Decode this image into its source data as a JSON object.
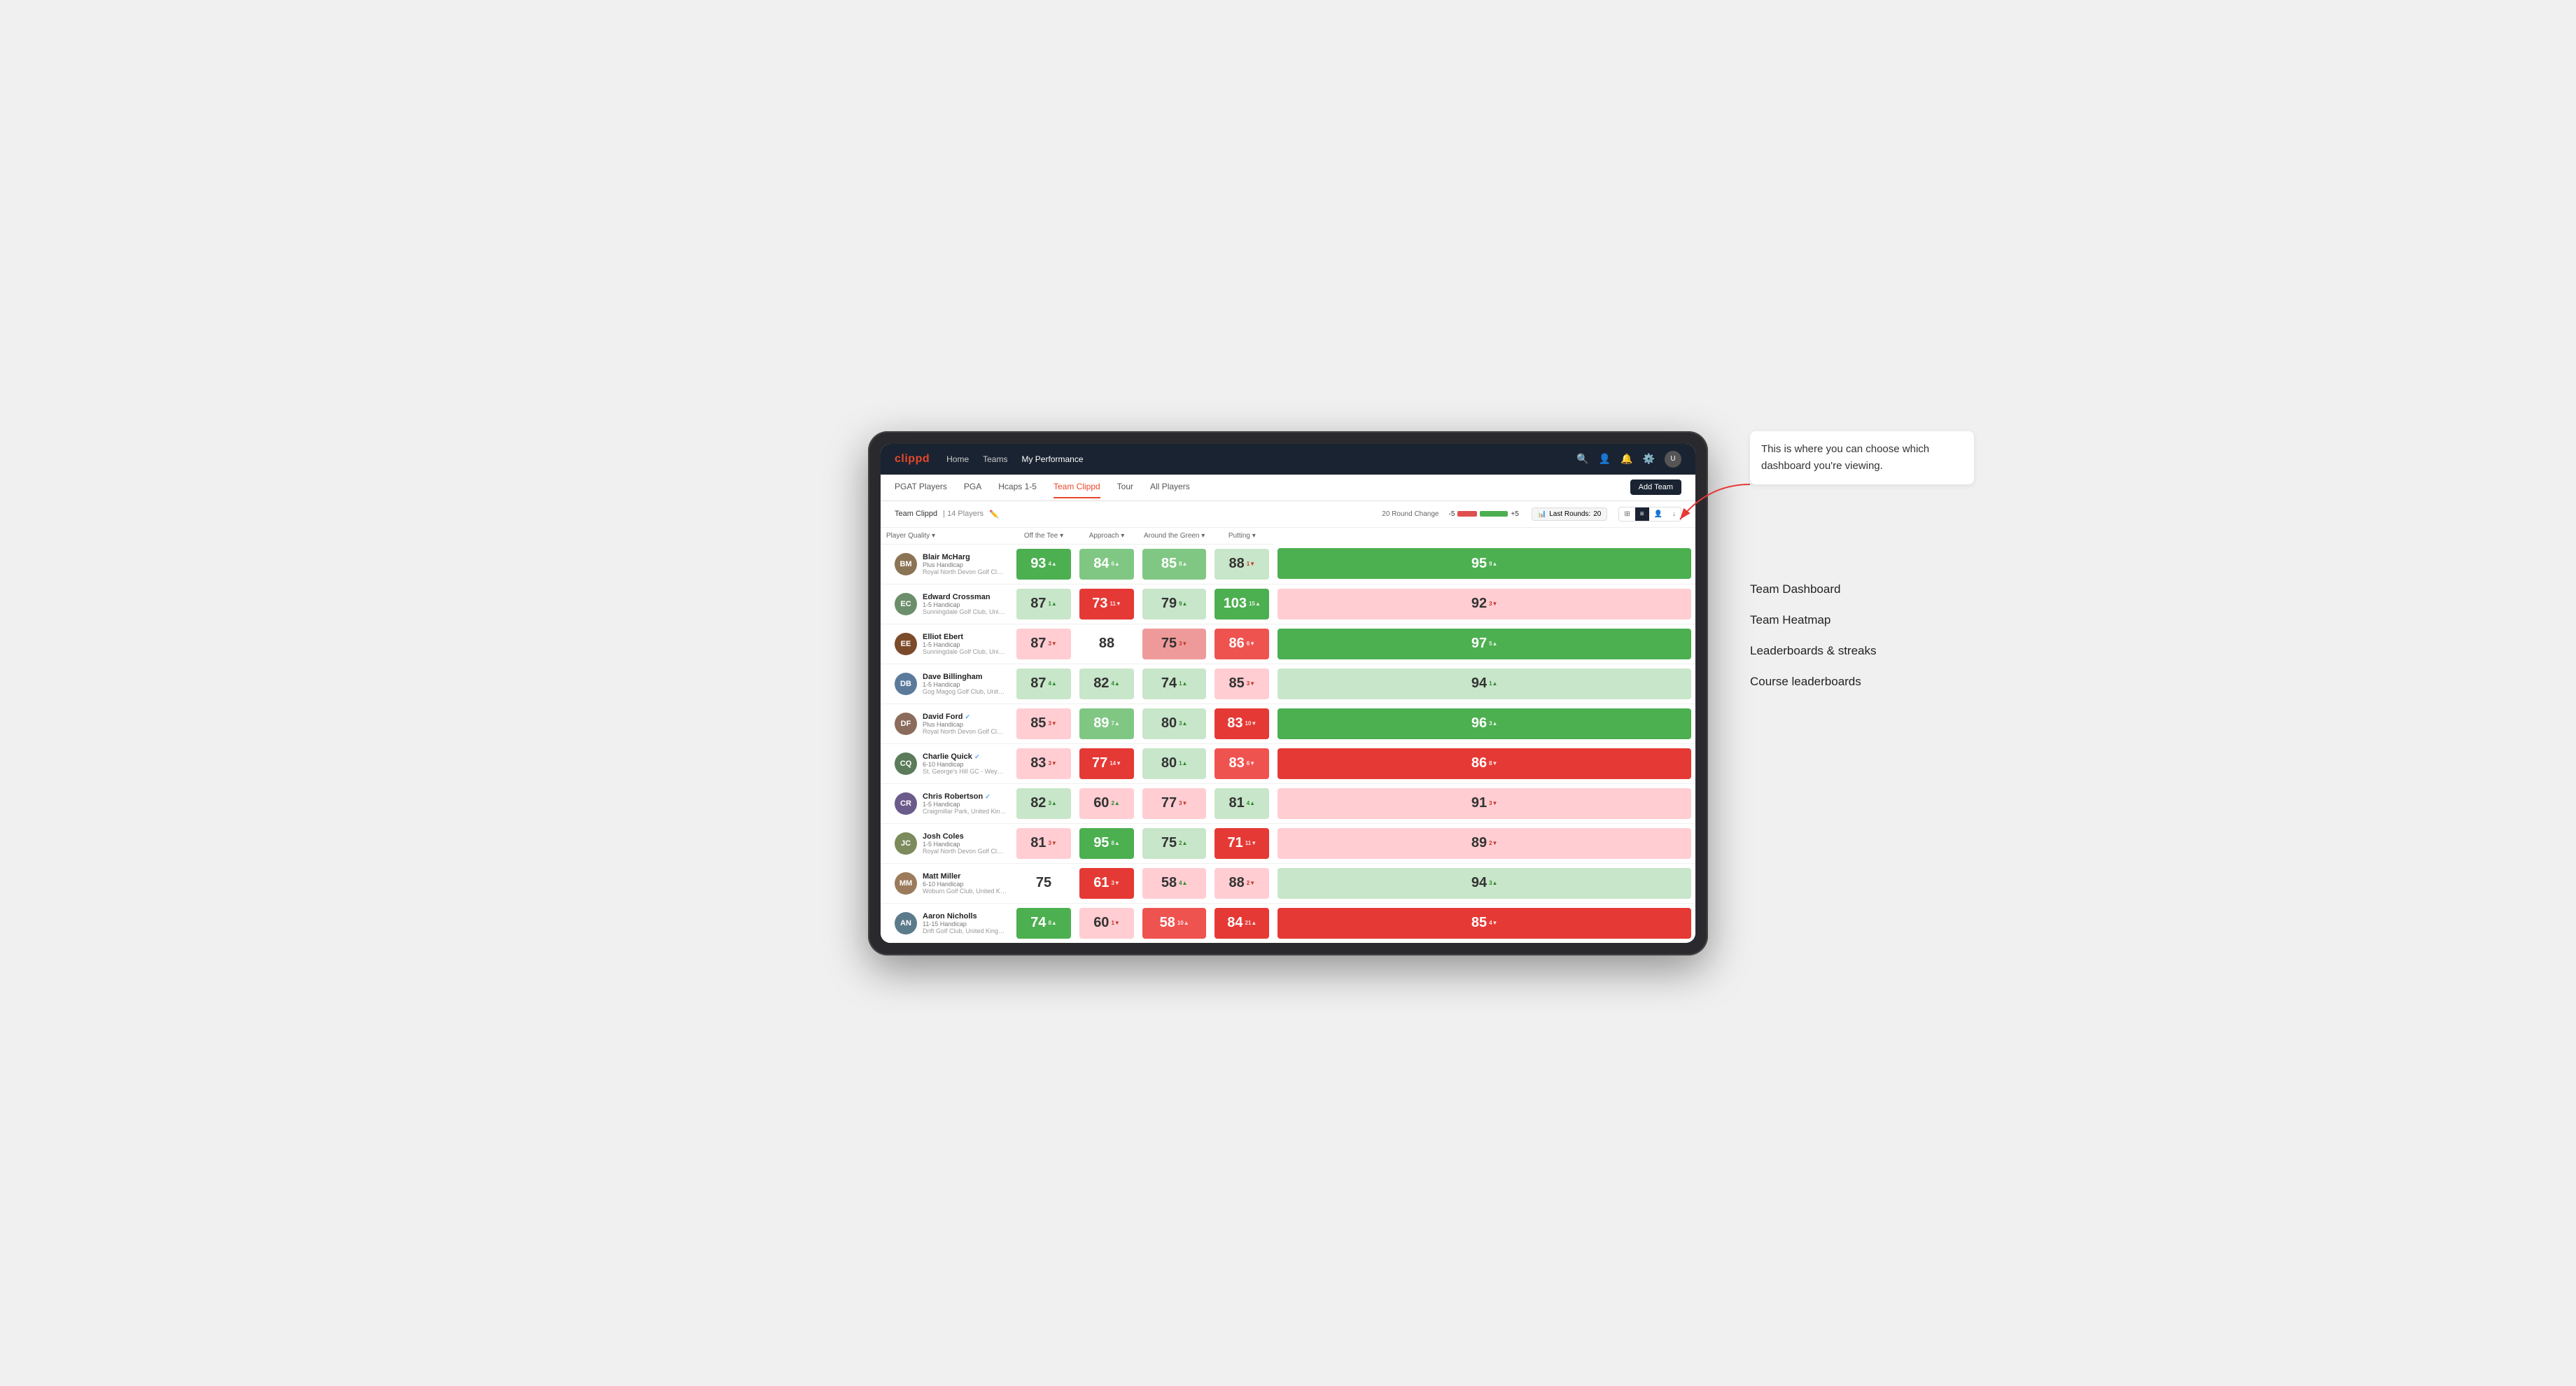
{
  "annotation": {
    "intro": "This is where you can choose which dashboard you're viewing.",
    "items": [
      "Team Dashboard",
      "Team Heatmap",
      "Leaderboards & streaks",
      "Course leaderboards"
    ]
  },
  "nav": {
    "logo": "clippd",
    "links": [
      "Home",
      "Teams",
      "My Performance"
    ],
    "active_link": "My Performance"
  },
  "secondary_nav": {
    "links": [
      "PGAT Players",
      "PGA",
      "Hcaps 1-5",
      "Team Clippd",
      "Tour",
      "All Players"
    ],
    "active": "Team Clippd",
    "add_team_label": "Add Team"
  },
  "team_bar": {
    "name": "Team Clippd",
    "separator": "|",
    "count": "14 Players",
    "round_change_label": "20 Round Change",
    "round_change_neg": "-5",
    "round_change_pos": "+5",
    "last_rounds_label": "Last Rounds:",
    "last_rounds_value": "20"
  },
  "table": {
    "columns": {
      "player_quality": "Player Quality ▾",
      "off_tee": "Off the Tee ▾",
      "approach": "Approach ▾",
      "around_green": "Around the Green ▾",
      "putting": "Putting ▾"
    },
    "rows": [
      {
        "name": "Blair McHarg",
        "handicap": "Plus Handicap",
        "club": "Royal North Devon Golf Club, United Kingdom",
        "initials": "BM",
        "color": "#8B7355",
        "scores": {
          "player_quality": {
            "value": 93,
            "change": 4,
            "dir": "up",
            "bg": "green-bright"
          },
          "off_tee": {
            "value": 84,
            "change": 6,
            "dir": "up",
            "bg": "green-med"
          },
          "approach": {
            "value": 85,
            "change": 8,
            "dir": "up",
            "bg": "green-med"
          },
          "around_green": {
            "value": 88,
            "change": 1,
            "dir": "down",
            "bg": "green-pale"
          },
          "putting": {
            "value": 95,
            "change": 9,
            "dir": "up",
            "bg": "green-bright"
          }
        }
      },
      {
        "name": "Edward Crossman",
        "handicap": "1-5 Handicap",
        "club": "Sunningdale Golf Club, United Kingdom",
        "initials": "EC",
        "color": "#6B8E6B",
        "scores": {
          "player_quality": {
            "value": 87,
            "change": 1,
            "dir": "up",
            "bg": "green-pale"
          },
          "off_tee": {
            "value": 73,
            "change": 11,
            "dir": "down",
            "bg": "red-bright"
          },
          "approach": {
            "value": 79,
            "change": 9,
            "dir": "up",
            "bg": "green-pale"
          },
          "around_green": {
            "value": 103,
            "change": 15,
            "dir": "up",
            "bg": "green-bright"
          },
          "putting": {
            "value": 92,
            "change": 3,
            "dir": "down",
            "bg": "red-pale"
          }
        }
      },
      {
        "name": "Elliot Ebert",
        "handicap": "1-5 Handicap",
        "club": "Sunningdale Golf Club, United Kingdom",
        "initials": "EE",
        "color": "#7B4A2A",
        "scores": {
          "player_quality": {
            "value": 87,
            "change": 3,
            "dir": "down",
            "bg": "red-pale"
          },
          "off_tee": {
            "value": 88,
            "change": null,
            "dir": null,
            "bg": "white"
          },
          "approach": {
            "value": 75,
            "change": 3,
            "dir": "down",
            "bg": "red-light"
          },
          "around_green": {
            "value": 86,
            "change": 6,
            "dir": "down",
            "bg": "red-med"
          },
          "putting": {
            "value": 97,
            "change": 5,
            "dir": "up",
            "bg": "green-bright"
          }
        }
      },
      {
        "name": "Dave Billingham",
        "handicap": "1-5 Handicap",
        "club": "Gog Magog Golf Club, United Kingdom",
        "initials": "DB",
        "color": "#5B7A9B",
        "scores": {
          "player_quality": {
            "value": 87,
            "change": 4,
            "dir": "up",
            "bg": "green-pale"
          },
          "off_tee": {
            "value": 82,
            "change": 4,
            "dir": "up",
            "bg": "green-pale"
          },
          "approach": {
            "value": 74,
            "change": 1,
            "dir": "up",
            "bg": "green-pale"
          },
          "around_green": {
            "value": 85,
            "change": 3,
            "dir": "down",
            "bg": "red-pale"
          },
          "putting": {
            "value": 94,
            "change": 1,
            "dir": "up",
            "bg": "green-pale"
          }
        }
      },
      {
        "name": "David Ford",
        "handicap": "Plus Handicap",
        "club": "Royal North Devon Golf Club, United Kingdom",
        "initials": "DF",
        "verified": true,
        "color": "#8B6B5B",
        "scores": {
          "player_quality": {
            "value": 85,
            "change": 3,
            "dir": "down",
            "bg": "red-pale"
          },
          "off_tee": {
            "value": 89,
            "change": 7,
            "dir": "up",
            "bg": "green-med"
          },
          "approach": {
            "value": 80,
            "change": 3,
            "dir": "up",
            "bg": "green-pale"
          },
          "around_green": {
            "value": 83,
            "change": 10,
            "dir": "down",
            "bg": "red-bright"
          },
          "putting": {
            "value": 96,
            "change": 3,
            "dir": "up",
            "bg": "green-bright"
          }
        }
      },
      {
        "name": "Charlie Quick",
        "handicap": "6-10 Handicap",
        "club": "St. George's Hill GC - Weybridge - Surrey, Uni...",
        "initials": "CQ",
        "verified": true,
        "color": "#5B7B5B",
        "scores": {
          "player_quality": {
            "value": 83,
            "change": 3,
            "dir": "down",
            "bg": "red-pale"
          },
          "off_tee": {
            "value": 77,
            "change": 14,
            "dir": "down",
            "bg": "red-bright"
          },
          "approach": {
            "value": 80,
            "change": 1,
            "dir": "up",
            "bg": "green-pale"
          },
          "around_green": {
            "value": 83,
            "change": 6,
            "dir": "down",
            "bg": "red-med"
          },
          "putting": {
            "value": 86,
            "change": 8,
            "dir": "down",
            "bg": "red-bright"
          }
        }
      },
      {
        "name": "Chris Robertson",
        "handicap": "1-5 Handicap",
        "club": "Craigmillar Park, United Kingdom",
        "initials": "CR",
        "verified": true,
        "color": "#6B5B8B",
        "scores": {
          "player_quality": {
            "value": 82,
            "change": 3,
            "dir": "up",
            "bg": "green-pale"
          },
          "off_tee": {
            "value": 60,
            "change": 2,
            "dir": "up",
            "bg": "red-pale"
          },
          "approach": {
            "value": 77,
            "change": 3,
            "dir": "down",
            "bg": "red-pale"
          },
          "around_green": {
            "value": 81,
            "change": 4,
            "dir": "up",
            "bg": "green-pale"
          },
          "putting": {
            "value": 91,
            "change": 3,
            "dir": "down",
            "bg": "red-pale"
          }
        }
      },
      {
        "name": "Josh Coles",
        "handicap": "1-5 Handicap",
        "club": "Royal North Devon Golf Club, United Kingdom",
        "initials": "JC",
        "color": "#7B8B5B",
        "scores": {
          "player_quality": {
            "value": 81,
            "change": 3,
            "dir": "down",
            "bg": "red-pale"
          },
          "off_tee": {
            "value": 95,
            "change": 8,
            "dir": "up",
            "bg": "green-bright"
          },
          "approach": {
            "value": 75,
            "change": 2,
            "dir": "up",
            "bg": "green-pale"
          },
          "around_green": {
            "value": 71,
            "change": 11,
            "dir": "down",
            "bg": "red-bright"
          },
          "putting": {
            "value": 89,
            "change": 2,
            "dir": "down",
            "bg": "red-pale"
          }
        }
      },
      {
        "name": "Matt Miller",
        "handicap": "6-10 Handicap",
        "club": "Woburn Golf Club, United Kingdom",
        "initials": "MM",
        "color": "#9B7B5B",
        "scores": {
          "player_quality": {
            "value": 75,
            "change": null,
            "dir": null,
            "bg": "white"
          },
          "off_tee": {
            "value": 61,
            "change": 3,
            "dir": "down",
            "bg": "red-bright"
          },
          "approach": {
            "value": 58,
            "change": 4,
            "dir": "up",
            "bg": "red-pale"
          },
          "around_green": {
            "value": 88,
            "change": 2,
            "dir": "down",
            "bg": "red-pale"
          },
          "putting": {
            "value": 94,
            "change": 3,
            "dir": "up",
            "bg": "green-pale"
          }
        }
      },
      {
        "name": "Aaron Nicholls",
        "handicap": "11-15 Handicap",
        "club": "Drift Golf Club, United Kingdom",
        "initials": "AN",
        "color": "#5B7B8B",
        "scores": {
          "player_quality": {
            "value": 74,
            "change": 8,
            "dir": "up",
            "bg": "green-bright"
          },
          "off_tee": {
            "value": 60,
            "change": 1,
            "dir": "down",
            "bg": "red-pale"
          },
          "approach": {
            "value": 58,
            "change": 10,
            "dir": "up",
            "bg": "red-med"
          },
          "around_green": {
            "value": 84,
            "change": 21,
            "dir": "up",
            "bg": "red-bright"
          },
          "putting": {
            "value": 85,
            "change": 4,
            "dir": "down",
            "bg": "red-bright"
          }
        }
      }
    ]
  }
}
